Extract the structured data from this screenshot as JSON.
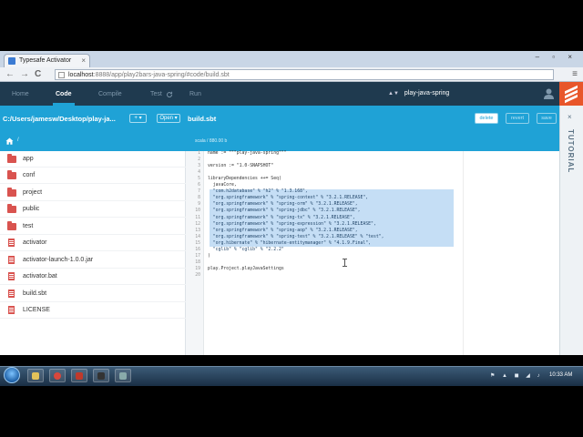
{
  "browser": {
    "tab_title": "Typesafe Activator",
    "tab_close": "×",
    "window_controls": "– ▫ ×",
    "back": "←",
    "forward": "→",
    "reload": "C",
    "url_host": "localhost",
    "url_path": ":8888/app/play2bars-java-spring/#code/build.sbt",
    "menu": "≡"
  },
  "app_nav": {
    "items": [
      "Home",
      "Code",
      "Compile",
      "Test",
      "Run"
    ],
    "active": "Code",
    "project_name": "play-java-spring",
    "project_arrows": "▲▼"
  },
  "toolbar": {
    "path": "C:/Users/jamesw/Desktop/play-ja...",
    "add_label": "+ ▾",
    "open_label": "Open ▾",
    "filename": "build.sbt",
    "delete_label": "delete",
    "revert_label": "revert",
    "save_label": "save",
    "tutorial_label": "TUTORIAL",
    "tutorial_close": "×"
  },
  "colors": {
    "accent": "#1fa2d6",
    "header": "#1f3a4f",
    "brand": "#e8562a",
    "icon_red": "#d9534f"
  },
  "sidebar": {
    "breadcrumb": "/",
    "items": [
      {
        "name": "app",
        "type": "folder"
      },
      {
        "name": "conf",
        "type": "folder"
      },
      {
        "name": "project",
        "type": "folder"
      },
      {
        "name": "public",
        "type": "folder"
      },
      {
        "name": "test",
        "type": "folder"
      },
      {
        "name": "activator",
        "type": "file"
      },
      {
        "name": "activator-launch-1.0.0.jar",
        "type": "file"
      },
      {
        "name": "activator.bat",
        "type": "file"
      },
      {
        "name": "build.sbt",
        "type": "file"
      },
      {
        "name": "LICENSE",
        "type": "file"
      }
    ]
  },
  "editor": {
    "info": "scala / 880.00 b",
    "lines": [
      {
        "n": "1",
        "text": "name := \"\"\"play-java-spring\"\"\""
      },
      {
        "n": "2",
        "text": ""
      },
      {
        "n": "3",
        "text": "version := \"1.0-SNAPSHOT\""
      },
      {
        "n": "4",
        "text": ""
      },
      {
        "n": "5",
        "text": "libraryDependencies ++= Seq("
      },
      {
        "n": "6",
        "text": "  javaCore,"
      },
      {
        "n": "7",
        "text": "  \"com.h2database\" % \"h2\" % \"1.3.168\","
      },
      {
        "n": "8",
        "text": "  \"org.springframework\" % \"spring-context\" % \"3.2.1.RELEASE\","
      },
      {
        "n": "9",
        "text": "  \"org.springframework\" % \"spring-orm\" % \"3.2.1.RELEASE\","
      },
      {
        "n": "10",
        "text": "  \"org.springframework\" % \"spring-jdbc\" % \"3.2.1.RELEASE\","
      },
      {
        "n": "11",
        "text": "  \"org.springframework\" % \"spring-tx\" % \"3.2.1.RELEASE\","
      },
      {
        "n": "12",
        "text": "  \"org.springframework\" % \"spring-expression\" % \"3.2.1.RELEASE\","
      },
      {
        "n": "13",
        "text": "  \"org.springframework\" % \"spring-aop\" % \"3.2.1.RELEASE\","
      },
      {
        "n": "14",
        "text": "  \"org.springframework\" % \"spring-test\" % \"3.2.1.RELEASE\" % \"test\","
      },
      {
        "n": "15",
        "text": "  \"org.hibernate\" % \"hibernate-entitymanager\" % \"4.1.9.Final\","
      },
      {
        "n": "16",
        "text": "  \"cglib\" % \"cglib\" % \"2.2.2\""
      },
      {
        "n": "17",
        "text": ")"
      },
      {
        "n": "18",
        "text": ""
      },
      {
        "n": "19",
        "text": "play.Project.playJavaSettings"
      },
      {
        "n": "20",
        "text": ""
      }
    ]
  },
  "taskbar": {
    "tray": "⚑ ▲ ◼ ◢ ♪",
    "clock": "10:33 AM"
  }
}
